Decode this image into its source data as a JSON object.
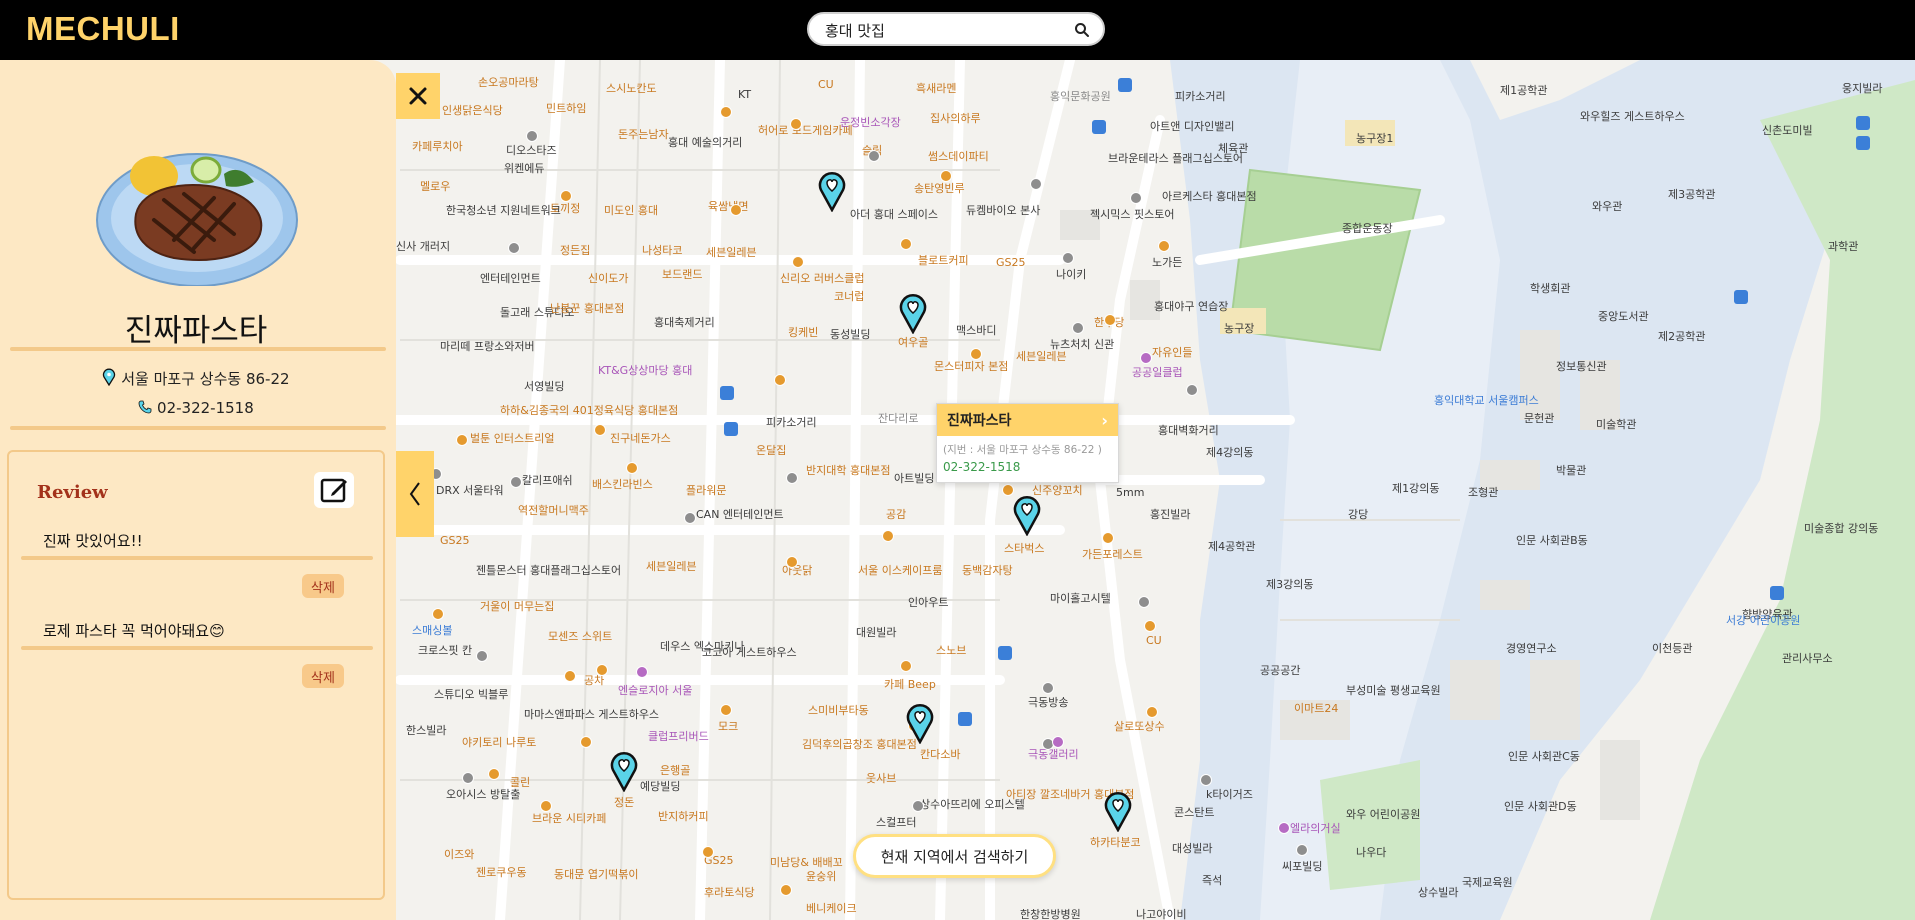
{
  "app": {
    "logo": "MECHULI"
  },
  "search": {
    "value": "홍대 맛집"
  },
  "restaurant": {
    "name": "진짜파스타",
    "address": "서울 마포구 상수동 86-22",
    "phone": "02-322-1518"
  },
  "review": {
    "title": "Review",
    "items": [
      {
        "text": "진짜 맛있어요!!",
        "delete_label": "삭제"
      },
      {
        "text": "로제 파스타 꼭 먹어야돼요😊",
        "delete_label": "삭제"
      }
    ]
  },
  "popup": {
    "name": "진짜파스타",
    "address": "(지번 : 서울 마포구 상수동 86-22 )",
    "phone": "02-322-1518"
  },
  "search_here_label": "현재 지역에서 검색하기",
  "map_labels": [
    "손오공마라탕",
    "스시노칸도",
    "CU",
    "홍대 예술의거리",
    "흑새라멘",
    "홍익문화공원",
    "피카소거리",
    "제1공학관",
    "와우힐즈 게스트하우스",
    "웅지빌라",
    "인생닭은식당",
    "민트하임",
    "돈주는남자",
    "KT",
    "허어로 보드게임카페",
    "운정빈소각장",
    "집사의하루",
    "신촌도미빌",
    "카페루치아",
    "디오스타즈",
    "위켄에듀",
    "농구장1",
    "아트앤 디자인밸리",
    "체육관",
    "멜로우",
    "토끼정",
    "미도인 홍대",
    "육쌈냉면",
    "슬릭",
    "썸스데이파티",
    "브라운테라스 플래그십스토어",
    "아르케스타 홍대본점",
    "한국청소년 지원네트워크",
    "나성타코",
    "아더 홍대 스페이스",
    "송탄영빈루",
    "듀켐바이오 본사",
    "젝시믹스 핏스토어",
    "제3공학관",
    "와우관",
    "신사 개러지",
    "정든집",
    "신이도가",
    "세븐일레븐",
    "보드랜드",
    "블로트커피",
    "GS25",
    "종합운동장",
    "노가든",
    "과학관",
    "엔터테인먼트",
    "신리오 러버스클럽",
    "코너럽",
    "나이키",
    "학생회관",
    "중앙도서관",
    "돌고래 스튜디오",
    "홍대축제거리",
    "킹케빈",
    "동성빌딩",
    "여우골",
    "맥스바디",
    "한주당",
    "홍대야구 연습장",
    "농구장",
    "난봉꾼 홍대본점",
    "제2공학관",
    "마리떼 프랑소와저버",
    "세븐일레븐",
    "뉴츠처치 신관",
    "몬스터피자 본점",
    "자유인들",
    "공공일클럽",
    "정보통신관",
    "KT&G상상마당 홍대",
    "서영빌딩",
    "하하&김종국의 401정육식당 홍대본점",
    "피카소거리",
    "잔다리로",
    "홍익대학교 서울캠퍼스",
    "문헌관",
    "미술학관",
    "벌툰 인터스트리얼",
    "진구네돈가스",
    "온달집",
    "반지대학 홍대본점",
    "아트빌딩",
    "홍대벽화거리",
    "제4강의동",
    "박물관",
    "칼리프애쉬",
    "배스킨라빈스",
    "DRX 서울타워",
    "플라워문",
    "신주양꼬치",
    "5mm",
    "제1강의동",
    "조형관",
    "역전할머니맥주",
    "홍진빌라",
    "강당",
    "CAN 엔터테인먼트",
    "공감",
    "미술종합 강의동",
    "GS25",
    "세븐일레븐",
    "스타벅스",
    "가든포레스트",
    "제4공학관",
    "인문 사회관B동",
    "젠틀몬스터 홍대플래그십스토어",
    "아웃닭",
    "서울 이스케이프룸",
    "동백감자탕",
    "제3강의동",
    "향방양육관",
    "거울이 머무는집",
    "인아우트",
    "마이홀고시텔",
    "서강 어린이공원",
    "스매싱볼",
    "모센즈 스위트",
    "데우스 엑스마키나",
    "대원빌라",
    "CU",
    "이천등관",
    "관리사무소",
    "크로스핏 칸",
    "코코아 게스트하우스",
    "스노브",
    "경영연구소",
    "공차",
    "엔슬로지아 서울",
    "카페 Beep",
    "극동방송",
    "공공공간",
    "부성미술 평생교육원",
    "스튜디오 빅블루",
    "마마스앤파파스 게스트하우스",
    "스미비부타동",
    "이마트24",
    "모크",
    "클럽프리버드",
    "김덕후의곱창조 홍대본점",
    "칸다소바",
    "살로또상수",
    "인문 사회관C동",
    "한스빌라",
    "야키토리 나루토",
    "은행골",
    "웃사브",
    "극동갤러리",
    "콜린",
    "오아시스 방탈출",
    "정돈",
    "예당빌딩",
    "상수아뜨리에 오피스텔",
    "아티장 깔조네바거 홍대본점",
    "하카타분코",
    "콘스탄트",
    "k타이거즈",
    "엘라의거실",
    "와우 어린이공원",
    "인문 사회관D동",
    "브라운 시티카페",
    "반지하커피",
    "스컬프터",
    "대성빌라",
    "이즈와",
    "젠로쿠우동",
    "동대문 엽기떡볶이",
    "미남당& 배배꼬",
    "윤숭위",
    "GS25",
    "나우다",
    "즉석",
    "국제교육원",
    "상수빌라",
    "씨포빌딩",
    "후라토식당",
    "베니케이크",
    "한창한방병원",
    "나고야이비"
  ]
}
